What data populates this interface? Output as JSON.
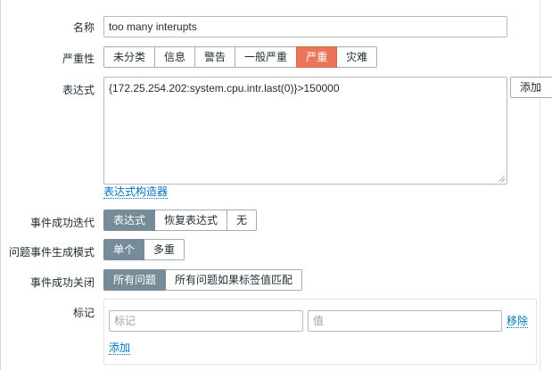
{
  "form": {
    "name": {
      "label": "名称",
      "value": "too many interupts"
    },
    "severity": {
      "label": "严重性",
      "options": [
        "未分类",
        "信息",
        "警告",
        "一般严重",
        "严重",
        "灾难"
      ],
      "selected": "严重"
    },
    "expression": {
      "label": "表达式",
      "value": "{172.25.254.202:system.cpu.intr.last(0)}>150000",
      "add_button": "添加",
      "builder_link": "表达式构造器"
    },
    "ok_event_generation": {
      "label": "事件成功迭代",
      "options": [
        "表达式",
        "恢复表达式",
        "无"
      ],
      "selected": "表达式"
    },
    "problem_event_mode": {
      "label": "问题事件生成模式",
      "options": [
        "单个",
        "多重"
      ],
      "selected": "单个"
    },
    "ok_event_closes": {
      "label": "事件成功关闭",
      "options": [
        "所有问题",
        "所有问题如果标签值匹配"
      ],
      "selected": "所有问题"
    },
    "tags": {
      "label": "标记",
      "tag_placeholder": "标记",
      "value_placeholder": "值",
      "remove_link": "移除",
      "add_link": "添加"
    }
  },
  "colors": {
    "selected_segment": "#768d99",
    "severity_high": "#e97659",
    "link": "#0275b8"
  }
}
